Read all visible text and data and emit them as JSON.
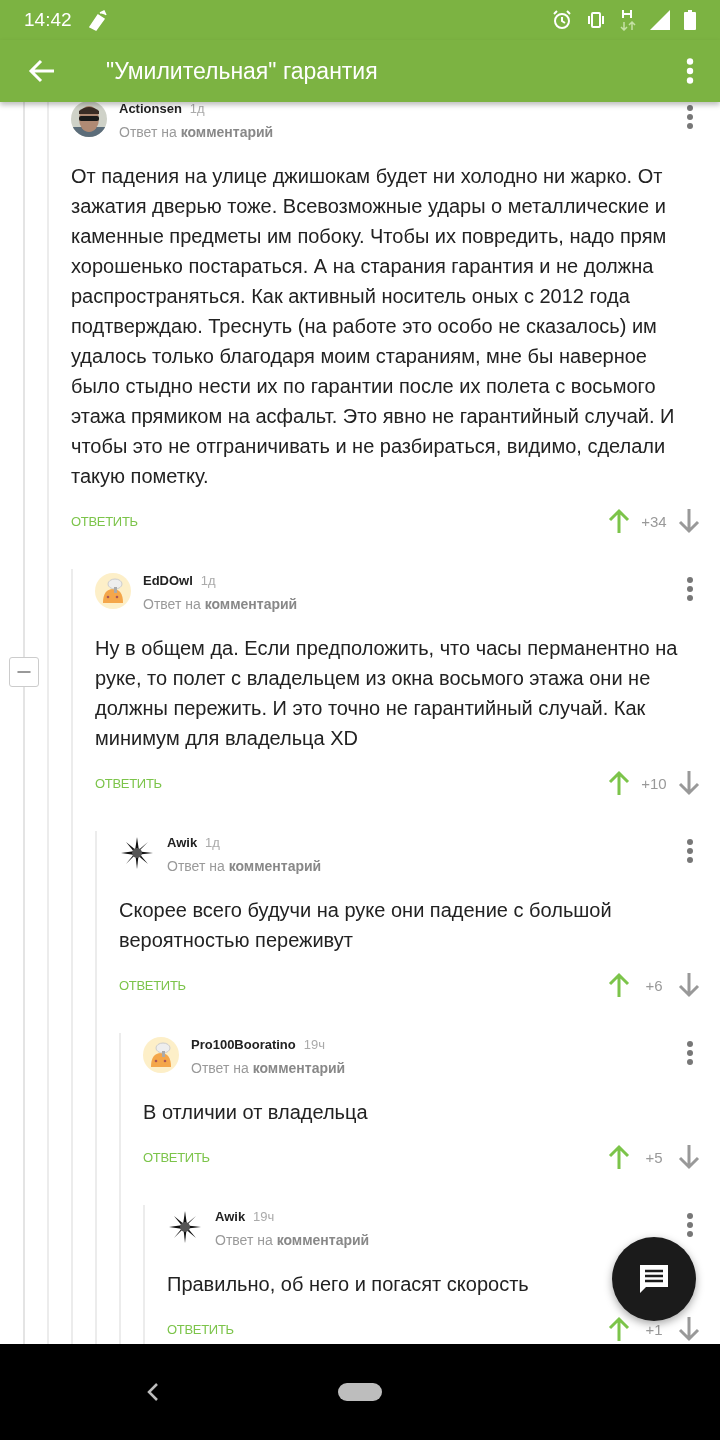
{
  "status_bar": {
    "time": "14:42"
  },
  "app_bar": {
    "title": "\"Умилительная\" гарантия"
  },
  "comments": [
    {
      "author": "Actionsen",
      "time": "1д",
      "reply_prefix": "Ответ на",
      "reply_target": "комментарий",
      "text": "От падения на улице джишокам будет ни холодно ни жарко. От зажатия дверью тоже. Всевозможные удары о металлические и каменные предметы им побоку. Чтобы их повредить, надо прям хорошенько постараться. А на старания гарантия и не должна распространяться. Как активный носитель оных с 2012 года подтверждаю. Треснуть (на работе это особо не сказалось) им удалось только благодаря моим стараниям, мне бы наверное было стыдно нести их по гарантии после их полета с восьмого этажа прямиком на асфальт. Это явно не гарантийный случай. И чтобы это не отграничивать и не разбираться, видимо, сделали такую пометку.",
      "reply_button": "ОТВЕТИТЬ",
      "score": "+34",
      "children": [
        {
          "author": "EdDOwl",
          "time": "1д",
          "avatar": {
            "kind": "cook"
          },
          "reply_prefix": "Ответ на",
          "reply_target": "комментарий",
          "text": "Ну в общем да. Если предположить, что часы перманентно на руке, то полет с владельцем из окна восьмого этажа они не должны пережить. И это точно не гарантийный случай. Как минимум для владельца XD",
          "reply_button": "ОТВЕТИТЬ",
          "score": "+10",
          "children": [
            {
              "author": "Awik",
              "time": "1д",
              "avatar": {
                "kind": "star"
              },
              "reply_prefix": "Ответ на",
              "reply_target": "комментарий",
              "text": "Скорее всего будучи на руке они падение с большой вероятностью переживут",
              "reply_button": "ОТВЕТИТЬ",
              "score": "+6",
              "children": [
                {
                  "author": "Pro100Booratino",
                  "time": "19ч",
                  "avatar": {
                    "kind": "cook"
                  },
                  "reply_prefix": "Ответ на",
                  "reply_target": "комментарий",
                  "text": "В отличии от владельца",
                  "reply_button": "ОТВЕТИТЬ",
                  "score": "+5",
                  "children": [
                    {
                      "author": "Awik",
                      "time": "19ч",
                      "avatar": {
                        "kind": "star"
                      },
                      "reply_prefix": "Ответ на",
                      "reply_target": "комментарий",
                      "text": "Правильно, об него и погасят скорость",
                      "reply_button": "ОТВЕТИТЬ",
                      "score": "+1"
                    }
                  ]
                }
              ]
            }
          ]
        }
      ]
    }
  ]
}
